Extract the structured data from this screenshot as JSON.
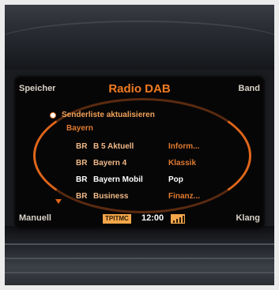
{
  "screen": {
    "title": "Radio DAB",
    "soft_keys": {
      "top_left": "Speicher",
      "top_right": "Band",
      "bottom_left": "Manuell",
      "bottom_right": "Klang"
    },
    "menu": {
      "refresh_item": "Senderliste aktualisieren",
      "group": "Bayern"
    },
    "stations": [
      {
        "src": "BR",
        "name": "B 5 Aktuell",
        "genre": "Inform..."
      },
      {
        "src": "BR",
        "name": "Bayern 4",
        "genre": "Klassik"
      },
      {
        "src": "BR",
        "name": "Bayern Mobil",
        "genre": "Pop"
      },
      {
        "src": "BR",
        "name": "Business",
        "genre": "Finanz..."
      }
    ],
    "status": {
      "tp_tmc": "TPITMC",
      "clock": "12:00"
    }
  },
  "colors": {
    "accent": "#e0661a",
    "highlight": "#f3a64a",
    "text": "#f0b888"
  }
}
